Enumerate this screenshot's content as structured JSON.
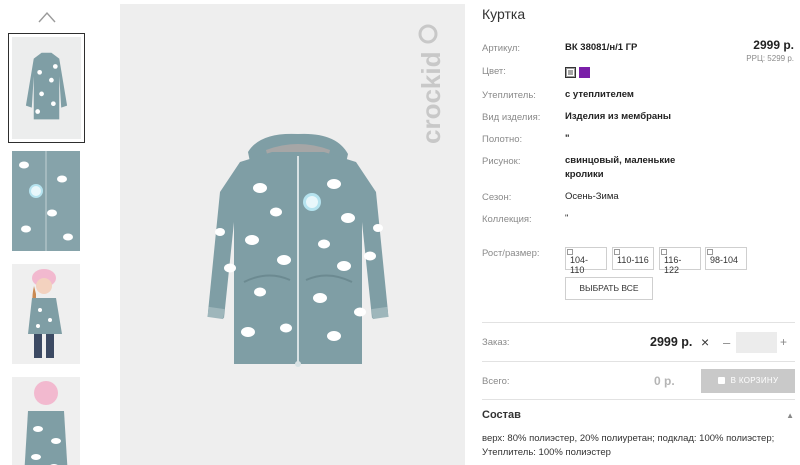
{
  "gallery": {
    "thumbnail_count": 4
  },
  "product": {
    "title": "Куртка",
    "price": "2999 р.",
    "rrp": "РРЦ: 5299 р.",
    "brand": "crockid",
    "swatch_colors": [
      "#a5a5a5",
      "#7a1fa8"
    ],
    "jacket_color": "#7f9ea5"
  },
  "specs": [
    {
      "label": "Артикул:",
      "value": "ВК 38081/н/1 ГР"
    },
    {
      "label": "Цвет:",
      "value": ""
    },
    {
      "label": "Утеплитель:",
      "value": "с утеплителем"
    },
    {
      "label": "Вид изделия:",
      "value": "Изделия из мембраны"
    },
    {
      "label": "Полотно:",
      "value": "\""
    },
    {
      "label": "Рисунок:",
      "value": "свинцовый, маленькие кролики"
    },
    {
      "label": "Сезон:",
      "value": "Осень-Зима"
    },
    {
      "label": "Коллекция:",
      "value": "\""
    }
  ],
  "sizes": {
    "label": "Рост/размер:",
    "options": [
      "104-110",
      "110-116",
      "116-122",
      "98-104"
    ],
    "select_all": "ВЫБРАТЬ ВСЕ"
  },
  "order": {
    "label": "Заказ:",
    "price": "2999 р.",
    "times": "×",
    "minus": "–",
    "plus": "+",
    "qty": ""
  },
  "total": {
    "label": "Всего:",
    "price": "0 р.",
    "cart_button": "В КОРЗИНУ"
  },
  "composition": {
    "title": "Состав",
    "arrow": "▲",
    "text": "верх: 80% полиэстер, 20% полиуретан; подклад: 100% полиэстер; Утеплитель: 100% полиэстер"
  }
}
